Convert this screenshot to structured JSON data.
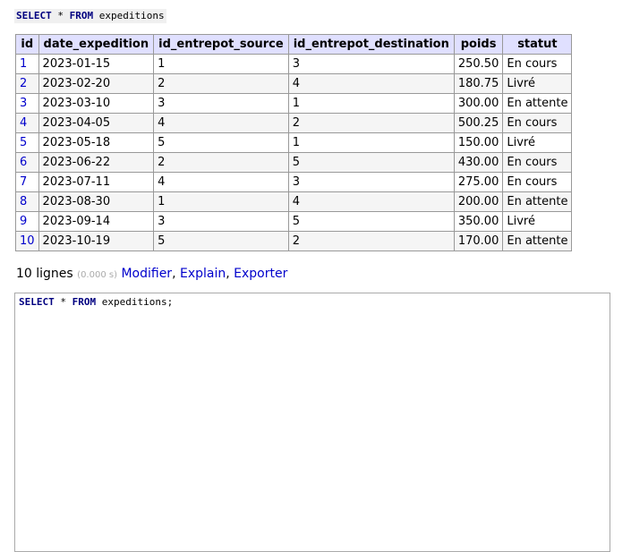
{
  "query_header": {
    "kw_select": "SELECT",
    "star": "*",
    "kw_from": "FROM",
    "table": "expeditions"
  },
  "table": {
    "columns": [
      "id",
      "date_expedition",
      "id_entrepot_source",
      "id_entrepot_destination",
      "poids",
      "statut"
    ],
    "rows": [
      [
        "1",
        "2023-01-15",
        "1",
        "3",
        "250.50",
        "En cours"
      ],
      [
        "2",
        "2023-02-20",
        "2",
        "4",
        "180.75",
        "Livré"
      ],
      [
        "3",
        "2023-03-10",
        "3",
        "1",
        "300.00",
        "En attente"
      ],
      [
        "4",
        "2023-04-05",
        "4",
        "2",
        "500.25",
        "En cours"
      ],
      [
        "5",
        "2023-05-18",
        "5",
        "1",
        "150.00",
        "Livré"
      ],
      [
        "6",
        "2023-06-22",
        "2",
        "5",
        "430.00",
        "En cours"
      ],
      [
        "7",
        "2023-07-11",
        "4",
        "3",
        "275.00",
        "En cours"
      ],
      [
        "8",
        "2023-08-30",
        "1",
        "4",
        "200.00",
        "En attente"
      ],
      [
        "9",
        "2023-09-14",
        "3",
        "5",
        "350.00",
        "Livré"
      ],
      [
        "10",
        "2023-10-19",
        "5",
        "2",
        "170.00",
        "En attente"
      ]
    ]
  },
  "footer": {
    "row_count": "10 lignes",
    "time": "(0.000 s)",
    "modify": "Modifier",
    "explain": "Explain",
    "export": "Exporter",
    "sep": ","
  },
  "editor": {
    "kw_select": "SELECT",
    "star": "*",
    "kw_from": "FROM",
    "table": "expeditions;"
  },
  "colors": {
    "header_bg": "#e0e0ff",
    "link": "#0000cc",
    "keyword": "#000080"
  }
}
